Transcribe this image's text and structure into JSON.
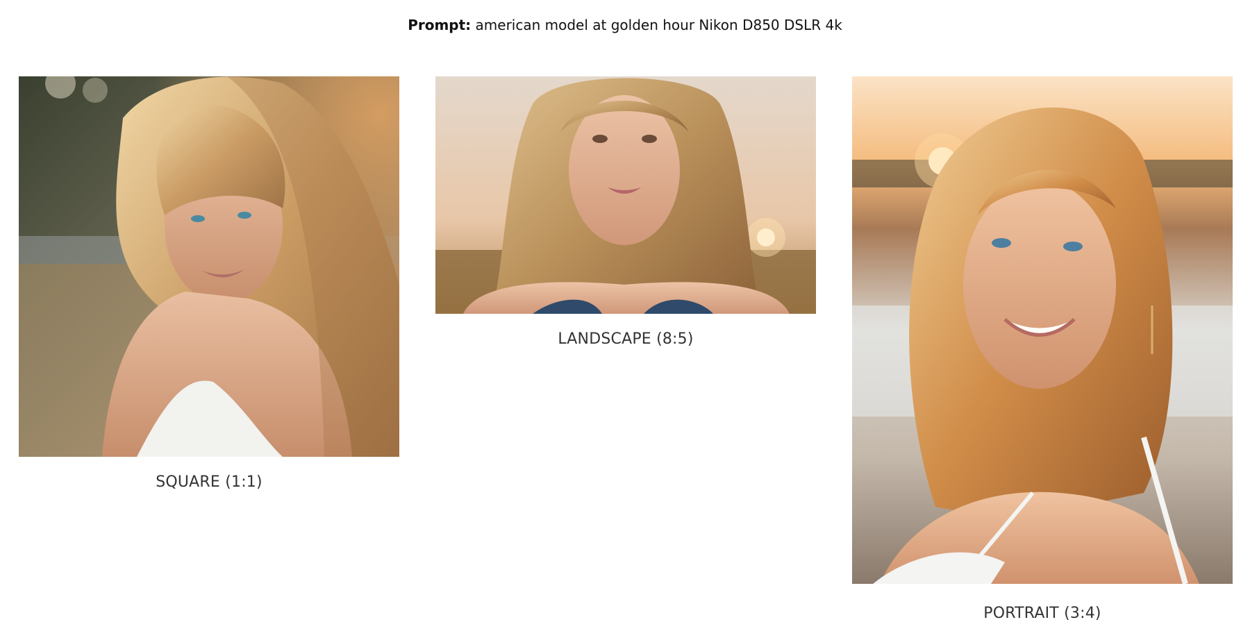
{
  "prompt": {
    "label": "Prompt:",
    "text": " american model at golden hour Nikon D850 DSLR 4k"
  },
  "images": [
    {
      "caption": "SQUARE (1:1)",
      "subject": "blonde woman with wavy hair in white top, golden hour backlight"
    },
    {
      "caption": "LANDSCAPE (8:5)",
      "subject": "blonde woman facing camera, sunset over field"
    },
    {
      "caption": "PORTRAIT (3:4)",
      "subject": "smiling blonde woman, sunset over water"
    }
  ],
  "colors": {
    "background": "#ffffff",
    "text": "#111111",
    "caption": "#333333"
  }
}
